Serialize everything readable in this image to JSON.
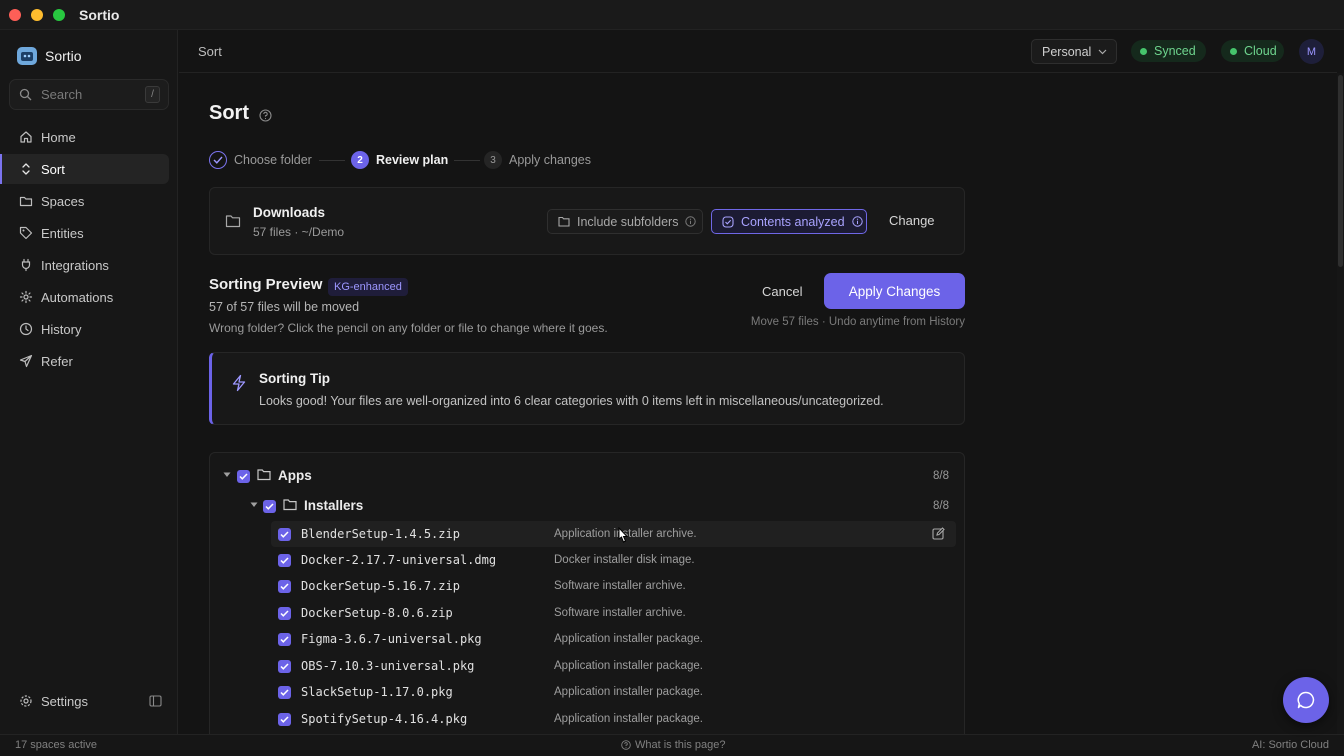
{
  "window": {
    "title": "Sortio"
  },
  "sidebar": {
    "brand": "Sortio",
    "search": {
      "placeholder": "Search",
      "shortcut": "/"
    },
    "items": [
      {
        "label": "Home",
        "icon": "home-icon"
      },
      {
        "label": "Sort",
        "icon": "sort-icon",
        "active": true
      },
      {
        "label": "Spaces",
        "icon": "folder-icon"
      },
      {
        "label": "Entities",
        "icon": "tag-icon"
      },
      {
        "label": "Integrations",
        "icon": "plug-icon"
      },
      {
        "label": "Automations",
        "icon": "automation-icon"
      },
      {
        "label": "History",
        "icon": "clock-icon"
      },
      {
        "label": "Refer",
        "icon": "send-icon"
      }
    ],
    "settings_label": "Settings"
  },
  "topbar": {
    "breadcrumb": "Sort",
    "workspace": "Personal",
    "sync_status": "Synced",
    "cloud_status": "Cloud",
    "avatar_initial": "M"
  },
  "page": {
    "title": "Sort",
    "steps": [
      {
        "label": "Choose folder",
        "state": "done"
      },
      {
        "number": "2",
        "label": "Review plan",
        "state": "current"
      },
      {
        "number": "3",
        "label": "Apply changes",
        "state": "pending"
      }
    ],
    "folder": {
      "name": "Downloads",
      "meta": "57 files · ~/Demo",
      "include_subfolders": "Include subfolders",
      "contents_analyzed": "Contents analyzed",
      "change": "Change"
    },
    "preview": {
      "title": "Sorting Preview",
      "badge": "KG-enhanced",
      "subtitle": "57 of 57 files will be moved",
      "hint": "Wrong folder? Click the pencil on any folder or file to change where it goes.",
      "cancel": "Cancel",
      "apply": "Apply Changes",
      "apply_note": "Move 57 files · Undo anytime from History"
    },
    "tip": {
      "title": "Sorting Tip",
      "body": "Looks good! Your files are well-organized into 6 clear categories with 0 items left in miscellaneous/uncategorized."
    },
    "tree": {
      "group": {
        "name": "Apps",
        "count": "8/8"
      },
      "subgroup": {
        "name": "Installers",
        "count": "8/8"
      },
      "files": [
        {
          "name": "BlenderSetup-1.4.5.zip",
          "desc": "Application installer archive."
        },
        {
          "name": "Docker-2.17.7-universal.dmg",
          "desc": "Docker installer disk image."
        },
        {
          "name": "DockerSetup-5.16.7.zip",
          "desc": "Software installer archive."
        },
        {
          "name": "DockerSetup-8.0.6.zip",
          "desc": "Software installer archive."
        },
        {
          "name": "Figma-3.6.7-universal.pkg",
          "desc": "Application installer package."
        },
        {
          "name": "OBS-7.10.3-universal.pkg",
          "desc": "Application installer package."
        },
        {
          "name": "SlackSetup-1.17.0.pkg",
          "desc": "Application installer package."
        },
        {
          "name": "SpotifySetup-4.16.4.pkg",
          "desc": "Application installer package."
        }
      ]
    }
  },
  "statusbar": {
    "left": "17 spaces active",
    "middle": "What is this page?",
    "right": "AI: Sortio Cloud"
  },
  "colors": {
    "accent": "#6c63e8",
    "success": "#46c46c",
    "background": "#141414"
  }
}
